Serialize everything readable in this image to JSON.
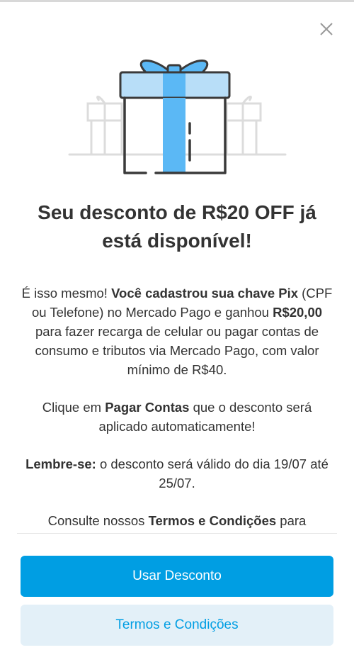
{
  "modal": {
    "title": "Seu desconto de R$20 OFF já está disponível!",
    "body": {
      "p1": {
        "t1": "É isso mesmo! ",
        "b1": "Você cadastrou sua chave Pix",
        "t2": " (CPF ou Telefone) no Mercado Pago e ganhou ",
        "b2": "R$20,00",
        "t3": " para fazer recarga de celular ou pagar contas de consumo e tributos via Mercado Pago, com valor mínimo de R$40."
      },
      "p2": {
        "t1": "Clique em ",
        "b1": "Pagar Contas",
        "t2": " que o desconto será aplicado automaticamente!"
      },
      "p3": {
        "b1": "Lembre-se:",
        "t1": " o desconto será válido do dia 19/07 até 25/07."
      },
      "p4": {
        "t1": "Consulte nossos ",
        "b1": "Termos e Condições",
        "t2": " para"
      }
    },
    "buttons": {
      "primary_label": "Usar Desconto",
      "secondary_label": "Termos e Condições"
    }
  },
  "icons": {
    "close": "close-icon",
    "illustration": "gift-box-illustration"
  },
  "colors": {
    "primary": "#009ee3",
    "secondary_bg": "#e3f0f8",
    "gift_accent": "#5bb8f5",
    "text": "#333333"
  }
}
